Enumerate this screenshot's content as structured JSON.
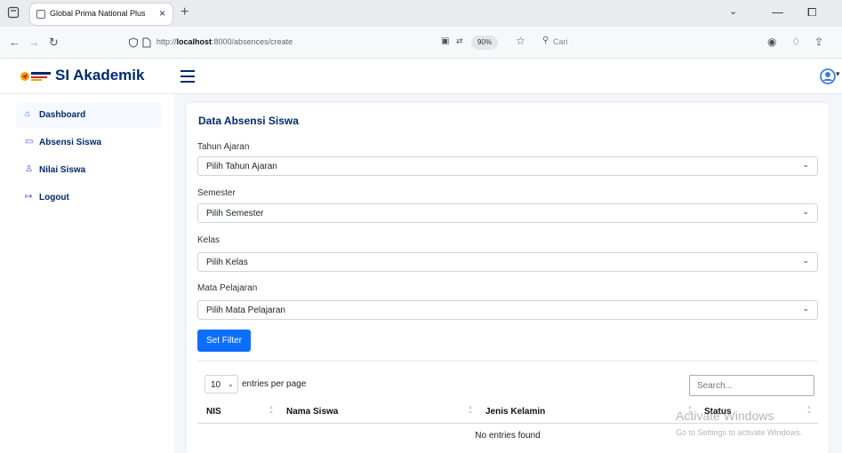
{
  "browser": {
    "tab_title": "Global Prima National Plus",
    "tab_close": "×",
    "new_tab": "+",
    "url_prefix": "http://",
    "url_host": "localhost",
    "url_path": ":8000/absences/create",
    "zoom": "90%",
    "search_placeholder": "Cari",
    "controls": {
      "minimize": "—",
      "maximize": "⧠"
    }
  },
  "app": {
    "brand": "SI Akademik",
    "accent": "#012970",
    "primary": "#0d6efd"
  },
  "sidebar": {
    "items": [
      {
        "label": "Dashboard",
        "icon": "home-icon",
        "glyph": "⌂"
      },
      {
        "label": "Absensi Siswa",
        "icon": "monitor-icon",
        "glyph": "▭"
      },
      {
        "label": "Nilai Siswa",
        "icon": "person-icon",
        "glyph": "♙"
      },
      {
        "label": "Logout",
        "icon": "logout-icon",
        "glyph": "↦"
      }
    ]
  },
  "form": {
    "title": "Data Absensi Siswa",
    "fields": [
      {
        "label": "Tahun Ajaran",
        "value": "Pilih Tahun Ajaran"
      },
      {
        "label": "Semester",
        "value": "Pilih Semester"
      },
      {
        "label": "Kelas",
        "value": "Pilih Kelas"
      },
      {
        "label": "Mata Pelajaran",
        "value": "Pilih Mata Pelajaran"
      }
    ],
    "filter_button": "Set Filter"
  },
  "table": {
    "entries_value": "10",
    "entries_label": "entries per page",
    "search_placeholder": "Search...",
    "columns": [
      "NIS",
      "Nama Siswa",
      "Jenis Kelamin",
      "Status"
    ],
    "empty_message": "No entries found"
  },
  "watermark": {
    "title": "Activate Windows",
    "subtitle": "Go to Settings to activate Windows."
  }
}
